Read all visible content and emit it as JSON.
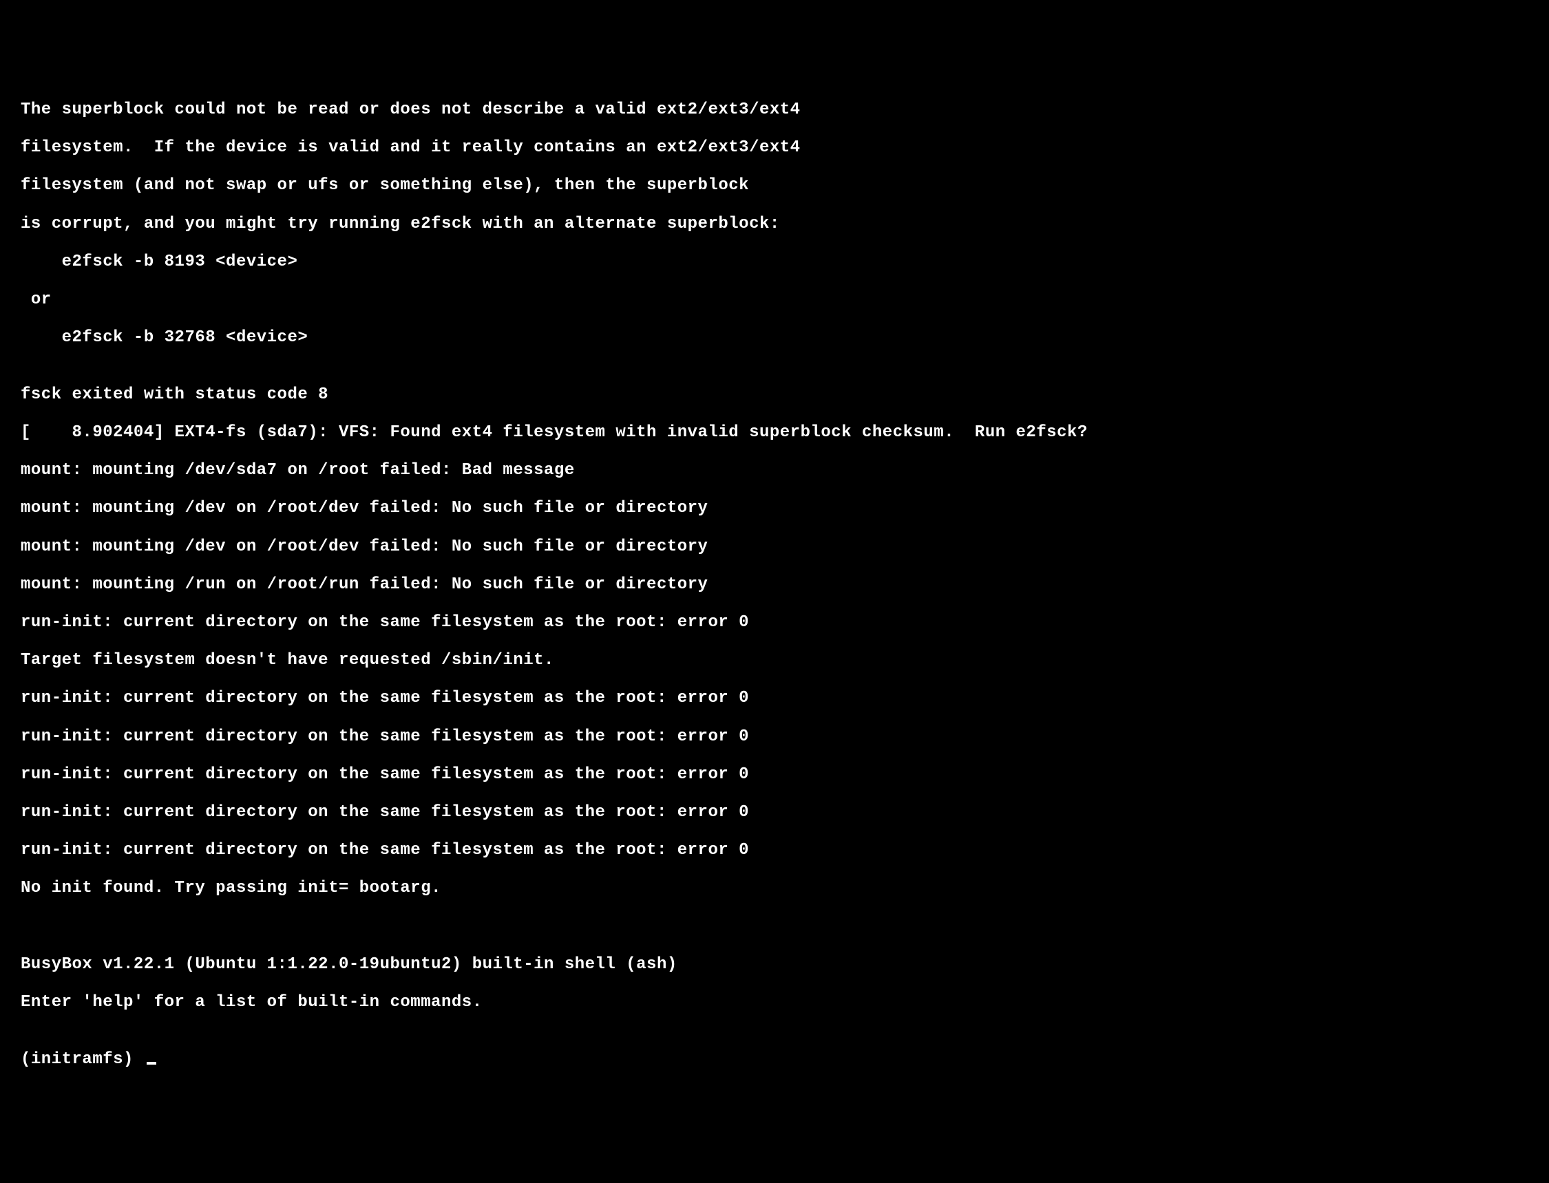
{
  "terminal": {
    "lines": [
      "The superblock could not be read or does not describe a valid ext2/ext3/ext4",
      "filesystem.  If the device is valid and it really contains an ext2/ext3/ext4",
      "filesystem (and not swap or ufs or something else), then the superblock",
      "is corrupt, and you might try running e2fsck with an alternate superblock:",
      "    e2fsck -b 8193 <device>",
      " or",
      "    e2fsck -b 32768 <device>",
      "",
      "fsck exited with status code 8",
      "[    8.902404] EXT4-fs (sda7): VFS: Found ext4 filesystem with invalid superblock checksum.  Run e2fsck?",
      "mount: mounting /dev/sda7 on /root failed: Bad message",
      "mount: mounting /dev on /root/dev failed: No such file or directory",
      "mount: mounting /dev on /root/dev failed: No such file or directory",
      "mount: mounting /run on /root/run failed: No such file or directory",
      "run-init: current directory on the same filesystem as the root: error 0",
      "Target filesystem doesn't have requested /sbin/init.",
      "run-init: current directory on the same filesystem as the root: error 0",
      "run-init: current directory on the same filesystem as the root: error 0",
      "run-init: current directory on the same filesystem as the root: error 0",
      "run-init: current directory on the same filesystem as the root: error 0",
      "run-init: current directory on the same filesystem as the root: error 0",
      "No init found. Try passing init= bootarg.",
      "",
      "",
      "BusyBox v1.22.1 (Ubuntu 1:1.22.0-19ubuntu2) built-in shell (ash)",
      "Enter 'help' for a list of built-in commands.",
      ""
    ],
    "prompt": "(initramfs) "
  }
}
